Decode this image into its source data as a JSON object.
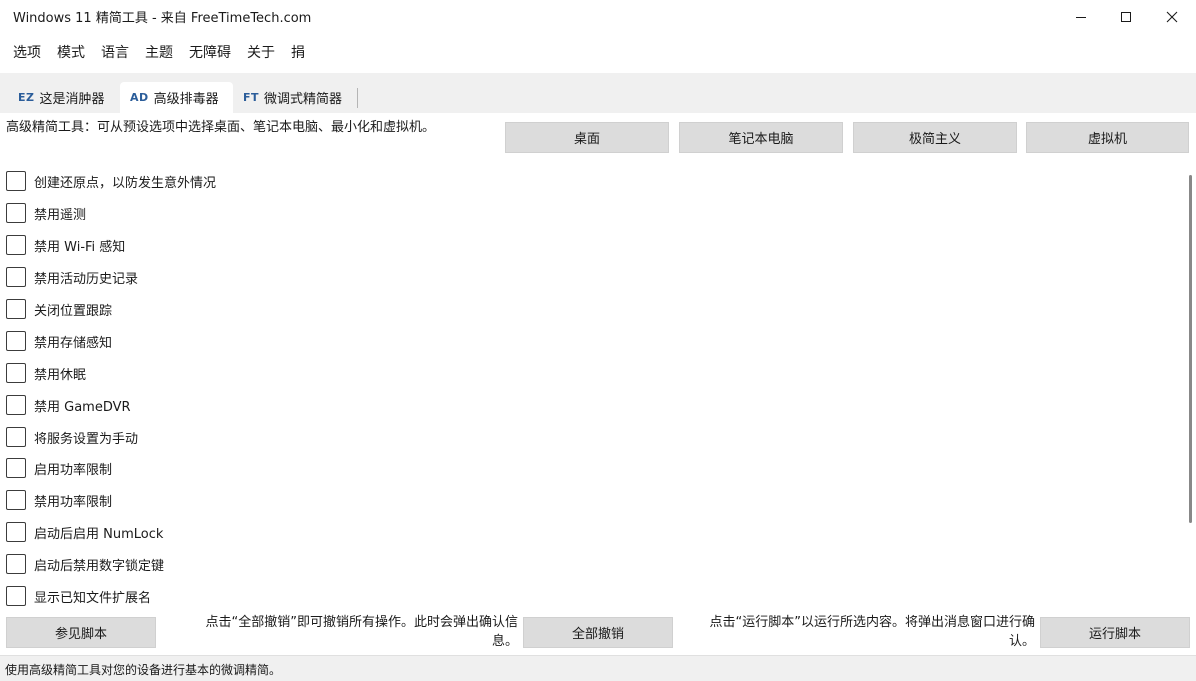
{
  "window": {
    "title": "Windows 11 精简工具 - 来自 FreeTimeTech.com",
    "controls": [
      "minimize-icon",
      "maximize-icon",
      "close-icon"
    ]
  },
  "menu": {
    "items": [
      "选项",
      "模式",
      "语言",
      "主题",
      "无障碍",
      "关于",
      "捐"
    ]
  },
  "tabs": [
    {
      "tag": "EZ",
      "label": "这是消肿器",
      "active": false
    },
    {
      "tag": "AD",
      "label": "高级排毒器",
      "active": true
    },
    {
      "tag": "FT",
      "label": "微调式精简器",
      "active": false
    }
  ],
  "content": {
    "description": "高级精简工具：可从预设选项中选择桌面、笔记本电脑、最小化和虚拟机。",
    "presets": [
      "桌面",
      "笔记本电脑",
      "极简主义",
      "虚拟机"
    ],
    "options": [
      {
        "label": "创建还原点，以防发生意外情况",
        "checked": false
      },
      {
        "label": "禁用遥测",
        "checked": false
      },
      {
        "label": "禁用 Wi-Fi 感知",
        "checked": false
      },
      {
        "label": "禁用活动历史记录",
        "checked": false
      },
      {
        "label": "关闭位置跟踪",
        "checked": false
      },
      {
        "label": "禁用存储感知",
        "checked": false
      },
      {
        "label": "禁用休眠",
        "checked": false
      },
      {
        "label": "禁用 GameDVR",
        "checked": false
      },
      {
        "label": "将服务设置为手动",
        "checked": false
      },
      {
        "label": "启用功率限制",
        "checked": false
      },
      {
        "label": "禁用功率限制",
        "checked": false
      },
      {
        "label": "启动后启用 NumLock",
        "checked": false
      },
      {
        "label": "启动后禁用数字锁定键",
        "checked": false
      },
      {
        "label": "显示已知文件扩展名",
        "checked": false
      }
    ]
  },
  "footer": {
    "view_script_label": "参见脚本",
    "undo_hint_line1": "点击“全部撤销”即可撤销所有操作。此时会弹出确认信",
    "undo_hint_line2": "息。",
    "undo_all_label": "全部撤销",
    "run_hint_line1": "点击“运行脚本”以运行所选内容。将弹出消息窗口进行确",
    "run_hint_line2": "认。",
    "run_script_label": "运行脚本"
  },
  "status": {
    "text": "使用高级精简工具对您的设备进行基本的微调精简。"
  }
}
